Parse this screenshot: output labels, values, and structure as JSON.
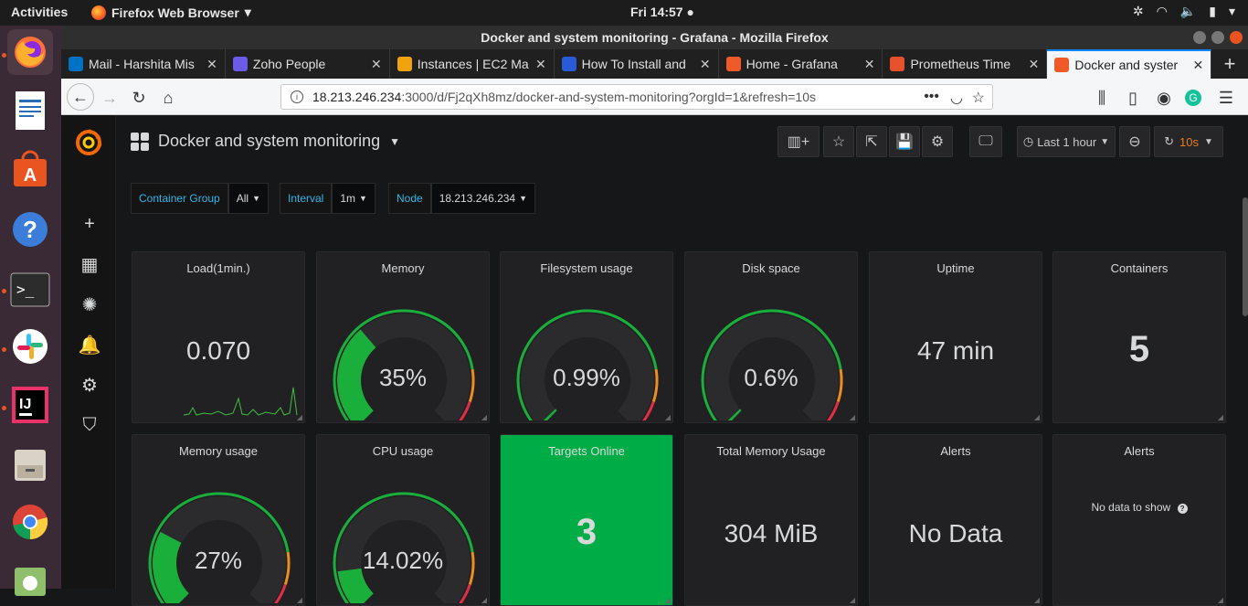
{
  "topbar": {
    "activities": "Activities",
    "app": "Firefox Web Browser",
    "clock": "Fri 14:57"
  },
  "window": {
    "title": "Docker and system monitoring - Grafana - Mozilla Firefox"
  },
  "tabs": [
    {
      "label": "Mail - Harshita Mis",
      "icon": "outlook-icon",
      "color": "#0072c6"
    },
    {
      "label": "Zoho People",
      "icon": "zoho-icon",
      "color": "#6b5ce7"
    },
    {
      "label": "Instances | EC2 Ma",
      "icon": "aws-icon",
      "color": "#f0a30a"
    },
    {
      "label": "How To Install and",
      "icon": "digitalocean-icon",
      "color": "#2a5bd7"
    },
    {
      "label": "Home - Grafana",
      "icon": "grafana-icon",
      "color": "#f05a28"
    },
    {
      "label": "Prometheus Time",
      "icon": "prometheus-icon",
      "color": "#e6522c"
    },
    {
      "label": "Docker and syster",
      "icon": "grafana-icon",
      "color": "#f05a28",
      "active": true
    }
  ],
  "nav": {
    "url_host": "18.213.246.234",
    "url_path": ":3000/d/Fj2qXh8mz/docker-and-system-monitoring?orgId=1&refresh=10s"
  },
  "grafana": {
    "dashboard_title": "Docker and system monitoring",
    "time_range": "Last 1 hour",
    "refresh": "10s",
    "variables": [
      {
        "label": "Container Group",
        "value": "All"
      },
      {
        "label": "Interval",
        "value": "1m"
      },
      {
        "label": "Node",
        "value": "18.213.246.234"
      }
    ],
    "panels": [
      {
        "title": "Load(1min.)",
        "value": "0.070",
        "type": "stat-spark"
      },
      {
        "title": "Memory",
        "value": "35%",
        "type": "gauge",
        "percent": 35
      },
      {
        "title": "Filesystem usage",
        "value": "0.99%",
        "type": "gauge",
        "percent": 0.99
      },
      {
        "title": "Disk space",
        "value": "0.6%",
        "type": "gauge",
        "percent": 0.6
      },
      {
        "title": "Uptime",
        "value": "47 min",
        "type": "stat"
      },
      {
        "title": "Containers",
        "value": "5",
        "type": "stat"
      },
      {
        "title": "Memory usage",
        "value": "27%",
        "type": "gauge",
        "percent": 27
      },
      {
        "title": "CPU usage",
        "value": "14.02%",
        "type": "gauge",
        "percent": 14.02
      },
      {
        "title": "Targets Online",
        "value": "3",
        "type": "stat",
        "bg": "#00ac46"
      },
      {
        "title": "Total Memory Usage",
        "value": "304 MiB",
        "type": "stat"
      },
      {
        "title": "Alerts",
        "value": "No Data",
        "type": "stat"
      },
      {
        "title": "Alerts",
        "value": "No data to show",
        "type": "nodata"
      }
    ],
    "colors": {
      "ok": "#1aae3b",
      "warn": "#ec8e1e",
      "crit": "#e02f44",
      "track": "#2b2b2d"
    }
  }
}
